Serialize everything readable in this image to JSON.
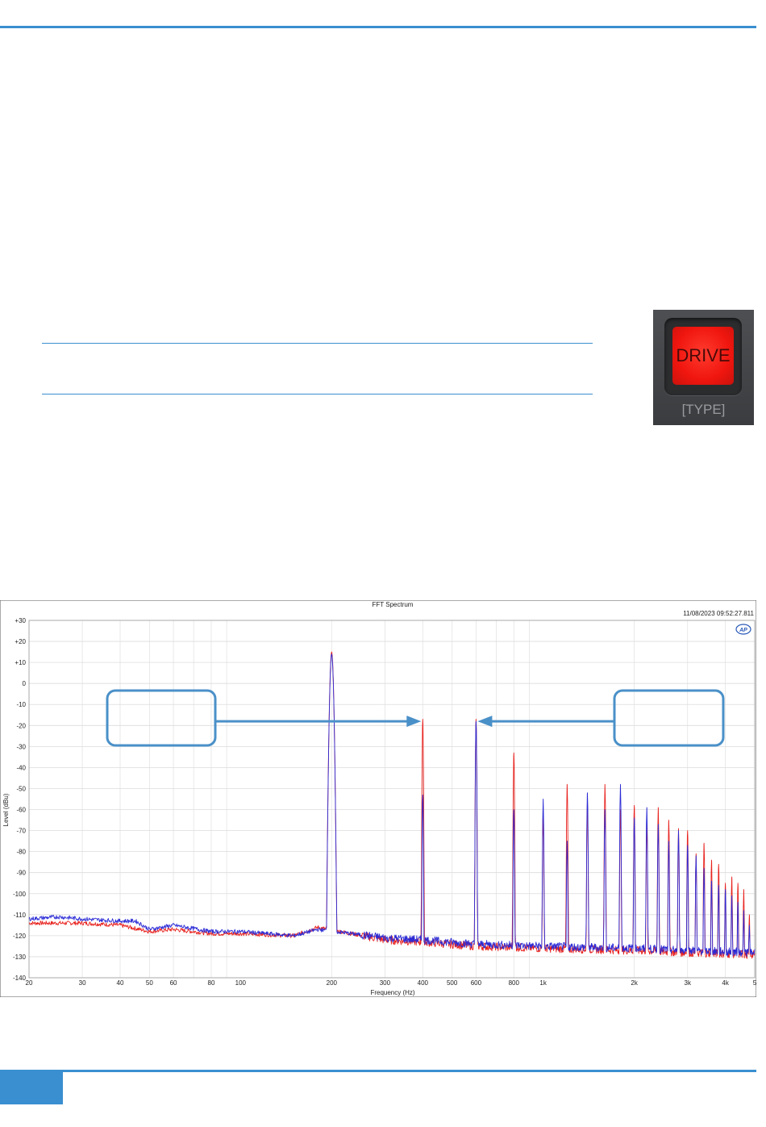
{
  "drive_button": {
    "label": "DRIVE",
    "sublabel": "[TYPE]"
  },
  "chart_data": {
    "type": "line",
    "title": "FFT Spectrum",
    "timestamp": "11/08/2023 09:52:27.811",
    "logo": "AP",
    "xlabel": "Frequency (Hz)",
    "ylabel": "Level (dBu)",
    "xscale": "log",
    "xlim": [
      20,
      5000
    ],
    "ylim": [
      -140,
      30
    ],
    "x_ticks": [
      20,
      30,
      40,
      50,
      60,
      80,
      100,
      200,
      300,
      400,
      500,
      600,
      800,
      1000,
      2000,
      3000,
      4000,
      5000
    ],
    "x_tick_labels": [
      "20",
      "30",
      "40",
      "50",
      "60",
      "80",
      "100",
      "200",
      "300",
      "400",
      "500",
      "600",
      "800",
      "1k",
      "2k",
      "3k",
      "4k",
      "5"
    ],
    "y_ticks": [
      30,
      20,
      10,
      0,
      -10,
      -20,
      -30,
      -40,
      -50,
      -60,
      -70,
      -80,
      -90,
      -100,
      -110,
      -120,
      -130,
      -140
    ],
    "y_tick_labels": [
      "+30",
      "+20",
      "+10",
      "0",
      "-10",
      "-20",
      "-30",
      "-40",
      "-50",
      "-60",
      "-70",
      "-80",
      "-90",
      "-100",
      "-110",
      "-120",
      "-130",
      "-140"
    ],
    "grid": true,
    "colors": {
      "red": "#e8221e",
      "blue": "#2b2bd6",
      "annotation": "#4a90c8"
    },
    "series": [
      {
        "color": "#e8221e",
        "noise_floor": [
          [
            20,
            -114
          ],
          [
            30,
            -114
          ],
          [
            40,
            -115
          ],
          [
            50,
            -118
          ],
          [
            60,
            -117
          ],
          [
            80,
            -119
          ],
          [
            100,
            -119
          ],
          [
            150,
            -120
          ],
          [
            180,
            -116
          ],
          [
            300,
            -122
          ],
          [
            400,
            -123
          ],
          [
            600,
            -125
          ],
          [
            1000,
            -126
          ],
          [
            2000,
            -127
          ],
          [
            3000,
            -128
          ],
          [
            5000,
            -129
          ]
        ],
        "peaks": [
          [
            200,
            15
          ],
          [
            400,
            -17
          ],
          [
            600,
            -17
          ],
          [
            800,
            -33
          ],
          [
            1000,
            -63
          ],
          [
            1200,
            -48
          ],
          [
            1400,
            -57
          ],
          [
            1600,
            -48
          ],
          [
            1800,
            -60
          ],
          [
            2000,
            -58
          ],
          [
            2200,
            -67
          ],
          [
            2400,
            -59
          ],
          [
            2600,
            -65
          ],
          [
            2800,
            -69
          ],
          [
            3000,
            -70
          ],
          [
            3200,
            -81
          ],
          [
            3400,
            -76
          ],
          [
            3600,
            -84
          ],
          [
            3800,
            -86
          ],
          [
            4000,
            -95
          ],
          [
            4200,
            -92
          ],
          [
            4400,
            -95
          ],
          [
            4600,
            -98
          ],
          [
            4800,
            -110
          ]
        ]
      },
      {
        "color": "#2b2bd6",
        "noise_floor": [
          [
            20,
            -112
          ],
          [
            25,
            -111
          ],
          [
            30,
            -112
          ],
          [
            40,
            -113
          ],
          [
            45,
            -113
          ],
          [
            50,
            -117
          ],
          [
            60,
            -115
          ],
          [
            80,
            -118
          ],
          [
            100,
            -118
          ],
          [
            150,
            -120
          ],
          [
            180,
            -117
          ],
          [
            300,
            -121
          ],
          [
            400,
            -122
          ],
          [
            600,
            -124
          ],
          [
            1000,
            -125
          ],
          [
            2000,
            -126
          ],
          [
            3000,
            -127
          ],
          [
            5000,
            -128
          ]
        ],
        "peaks": [
          [
            200,
            14
          ],
          [
            400,
            -53
          ],
          [
            600,
            -18
          ],
          [
            800,
            -60
          ],
          [
            1000,
            -55
          ],
          [
            1200,
            -75
          ],
          [
            1400,
            -52
          ],
          [
            1600,
            -60
          ],
          [
            1800,
            -48
          ],
          [
            2000,
            -64
          ],
          [
            2200,
            -59
          ],
          [
            2400,
            -67
          ],
          [
            2600,
            -75
          ],
          [
            2800,
            -70
          ],
          [
            3000,
            -77
          ],
          [
            3200,
            -82
          ],
          [
            3400,
            -88
          ],
          [
            3600,
            -94
          ],
          [
            3800,
            -96
          ],
          [
            4000,
            -98
          ],
          [
            4200,
            -101
          ],
          [
            4400,
            -104
          ],
          [
            4600,
            -108
          ],
          [
            4800,
            -115
          ]
        ]
      }
    ],
    "annotations": [
      {
        "type": "box-arrow",
        "box_side": "left",
        "target": [
          400,
          -18
        ]
      },
      {
        "type": "box-arrow",
        "box_side": "right",
        "target": [
          600,
          -18
        ]
      }
    ]
  }
}
